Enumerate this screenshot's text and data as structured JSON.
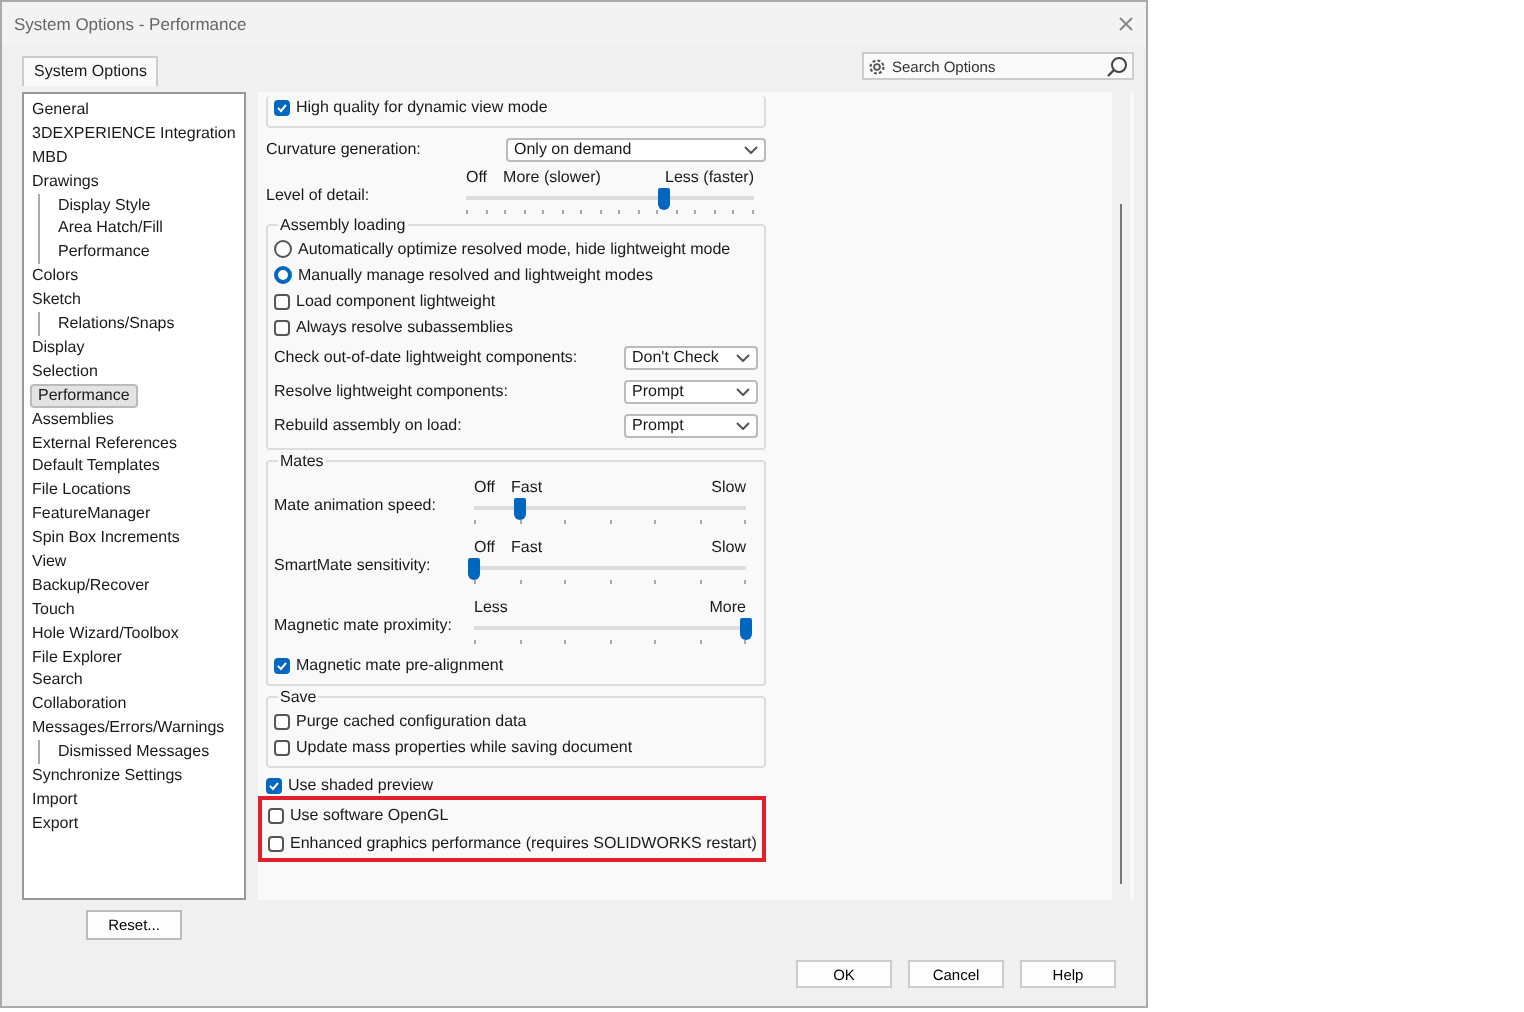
{
  "window": {
    "title": "System Options - Performance"
  },
  "tabs": [
    {
      "label": "System Options",
      "selected": true
    }
  ],
  "search": {
    "placeholder": "Search Options"
  },
  "sidebar": {
    "items": [
      {
        "label": "General",
        "selected": false
      },
      {
        "label": "3DEXPERIENCE Integration",
        "selected": false
      },
      {
        "label": "MBD",
        "selected": false
      },
      {
        "label": "Drawings",
        "selected": false,
        "children": [
          {
            "label": "Display Style",
            "selected": false
          },
          {
            "label": "Area Hatch/Fill",
            "selected": false
          },
          {
            "label": "Performance",
            "selected": false
          }
        ]
      },
      {
        "label": "Colors",
        "selected": false
      },
      {
        "label": "Sketch",
        "selected": false,
        "children": [
          {
            "label": "Relations/Snaps",
            "selected": false
          }
        ]
      },
      {
        "label": "Display",
        "selected": false
      },
      {
        "label": "Selection",
        "selected": false
      },
      {
        "label": "Performance",
        "selected": true
      },
      {
        "label": "Assemblies",
        "selected": false
      },
      {
        "label": "External References",
        "selected": false
      },
      {
        "label": "Default Templates",
        "selected": false
      },
      {
        "label": "File Locations",
        "selected": false
      },
      {
        "label": "FeatureManager",
        "selected": false
      },
      {
        "label": "Spin Box Increments",
        "selected": false
      },
      {
        "label": "View",
        "selected": false
      },
      {
        "label": "Backup/Recover",
        "selected": false
      },
      {
        "label": "Touch",
        "selected": false
      },
      {
        "label": "Hole Wizard/Toolbox",
        "selected": false
      },
      {
        "label": "File Explorer",
        "selected": false
      },
      {
        "label": "Search",
        "selected": false
      },
      {
        "label": "Collaboration",
        "selected": false
      },
      {
        "label": "Messages/Errors/Warnings",
        "selected": false,
        "children": [
          {
            "label": "Dismissed Messages",
            "selected": false
          }
        ]
      },
      {
        "label": "Synchronize Settings",
        "selected": false
      },
      {
        "label": "Import",
        "selected": false
      },
      {
        "label": "Export",
        "selected": false
      }
    ]
  },
  "reset_button": "Reset...",
  "content": [
    {
      "kind": "group",
      "items": [
        {
          "kind": "checkbox",
          "label": "High quality for dynamic view mode",
          "checked": true
        }
      ]
    },
    {
      "kind": "dropdown",
      "label": "Curvature generation:",
      "value": "Only on demand"
    },
    {
      "kind": "slider",
      "label": "Level of detail:",
      "marks": [
        "Off",
        "More (slower)",
        "Less (faster)"
      ],
      "level": 0.69
    },
    {
      "kind": "group",
      "title": "Assembly loading",
      "items": [
        {
          "kind": "radio",
          "label": "Automatically optimize resolved mode, hide lightweight mode",
          "selected": false
        },
        {
          "kind": "radio",
          "label": "Manually manage resolved and lightweight modes",
          "selected": true
        },
        {
          "kind": "checkbox",
          "label": "Load component lightweight",
          "checked": false
        },
        {
          "kind": "checkbox",
          "label": "Always resolve subassemblies",
          "checked": false
        },
        {
          "kind": "dropdown",
          "label": "Check out-of-date lightweight components:",
          "value": "Don't Check"
        },
        {
          "kind": "dropdown",
          "label": "Resolve lightweight components:",
          "value": "Prompt"
        },
        {
          "kind": "dropdown",
          "label": "Rebuild assembly on load:",
          "value": "Prompt"
        }
      ]
    },
    {
      "kind": "group",
      "title": "Mates",
      "items": [
        {
          "kind": "slider",
          "label": "Mate animation speed:",
          "marks": [
            "Off",
            "Fast",
            "Slow"
          ],
          "level": 0.17
        },
        {
          "kind": "slider",
          "label": "SmartMate sensitivity:",
          "marks": [
            "Off",
            "Fast",
            "Slow"
          ],
          "level": 0
        },
        {
          "kind": "slider",
          "label": "Magnetic mate proximity:",
          "marks": [
            "Less",
            "More"
          ],
          "level": 1
        },
        {
          "kind": "checkbox",
          "label": "Magnetic mate pre-alignment",
          "checked": true
        }
      ]
    },
    {
      "kind": "group",
      "title": "Save",
      "items": [
        {
          "kind": "checkbox",
          "label": "Purge cached configuration data",
          "checked": false
        },
        {
          "kind": "checkbox",
          "label": "Update mass properties while saving document",
          "checked": false
        }
      ]
    },
    {
      "kind": "checkbox",
      "label": "Use shaded preview",
      "checked": true
    },
    {
      "kind": "highlight",
      "items": [
        {
          "kind": "checkbox",
          "label": "Use software OpenGL",
          "checked": false
        },
        {
          "kind": "checkbox",
          "label": "Enhanced graphics performance (requires SOLIDWORKS restart)",
          "checked": false
        }
      ]
    }
  ],
  "buttons": [
    "OK",
    "Cancel",
    "Help"
  ]
}
